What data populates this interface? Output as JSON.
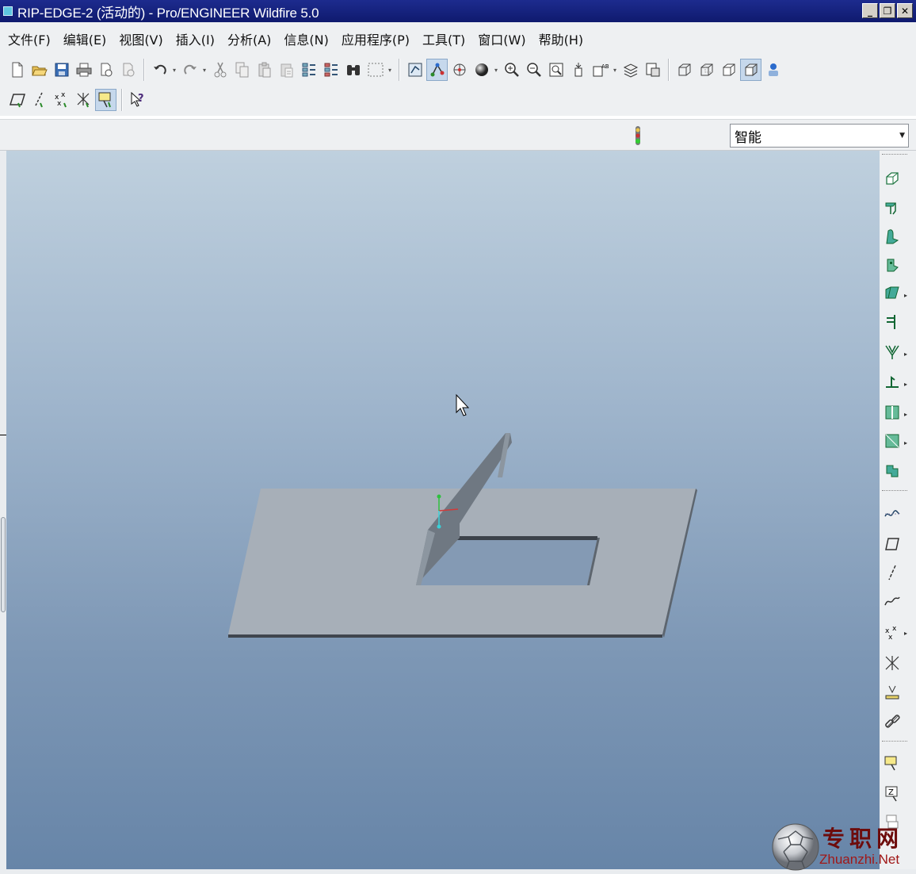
{
  "window": {
    "title": "RIP-EDGE-2 (活动的) - Pro/ENGINEER Wildfire 5.0",
    "buttons": {
      "minimize": "_",
      "restore": "❐",
      "close": "✕"
    }
  },
  "menu": {
    "items": [
      "文件(F)",
      "编辑(E)",
      "视图(V)",
      "插入(I)",
      "分析(A)",
      "信息(N)",
      "应用程序(P)",
      "工具(T)",
      "窗口(W)",
      "帮助(H)"
    ]
  },
  "toolbar1": {
    "icons": [
      "new-icon",
      "open-icon",
      "save-icon",
      "print-icon",
      "send-mail-icon",
      "send-attachment-icon",
      "undo-icon",
      "redo-icon",
      "cut-icon",
      "copy-icon",
      "paste-icon",
      "paste-special-icon",
      "regenerate-icon",
      "regen-manager-icon",
      "find-icon",
      "select-box-icon",
      "refit-view-icon",
      "datum-display-icon",
      "spin-center-icon",
      "shading-icon",
      "zoom-in-icon",
      "zoom-out-icon",
      "refit-icon",
      "reorient-icon",
      "saved-views-icon",
      "layers-icon",
      "view-manager-icon",
      "wireframe-icon",
      "hidden-line-icon",
      "no-hidden-icon",
      "shaded-icon",
      "model-tree-icon"
    ]
  },
  "toolbar2": {
    "icons": [
      "datum-plane-toggle-icon",
      "datum-axis-toggle-icon",
      "datum-point-toggle-icon",
      "coord-sys-toggle-icon",
      "annotation-toggle-icon",
      "context-help-icon"
    ]
  },
  "status": {
    "filter_value": "智能"
  },
  "right_toolbar": {
    "icons": [
      "sheetmetal-wall-icon",
      "flange-wall-icon",
      "flat-wall-icon",
      "extrude-wall-icon",
      "twist-wall-icon",
      "bend-icon",
      "unbend-icon",
      "edge-bend-icon",
      "rip-icon",
      "corner-relief-icon",
      "convert-icon",
      "datum-curve-icon",
      "datum-plane-icon",
      "datum-axis-icon",
      "sketch-curve-icon",
      "datum-point-icon",
      "coordinate-system-icon",
      "analysis-feature-icon",
      "chain-link-icon",
      "annotation-feature-icon",
      "note-icon",
      "more-icon"
    ]
  },
  "watermark": {
    "cn": "专职网",
    "en": "Zhuanzhi.Net"
  },
  "colors": {
    "title_bar": "#1d2b8e",
    "chrome": "#eef0f2",
    "viewport_top": "#bfd0de",
    "viewport_bottom": "#6785a8",
    "part_face": "#a4acb5",
    "part_edge": "#3a3f46",
    "wall_face": "#6e7780"
  }
}
